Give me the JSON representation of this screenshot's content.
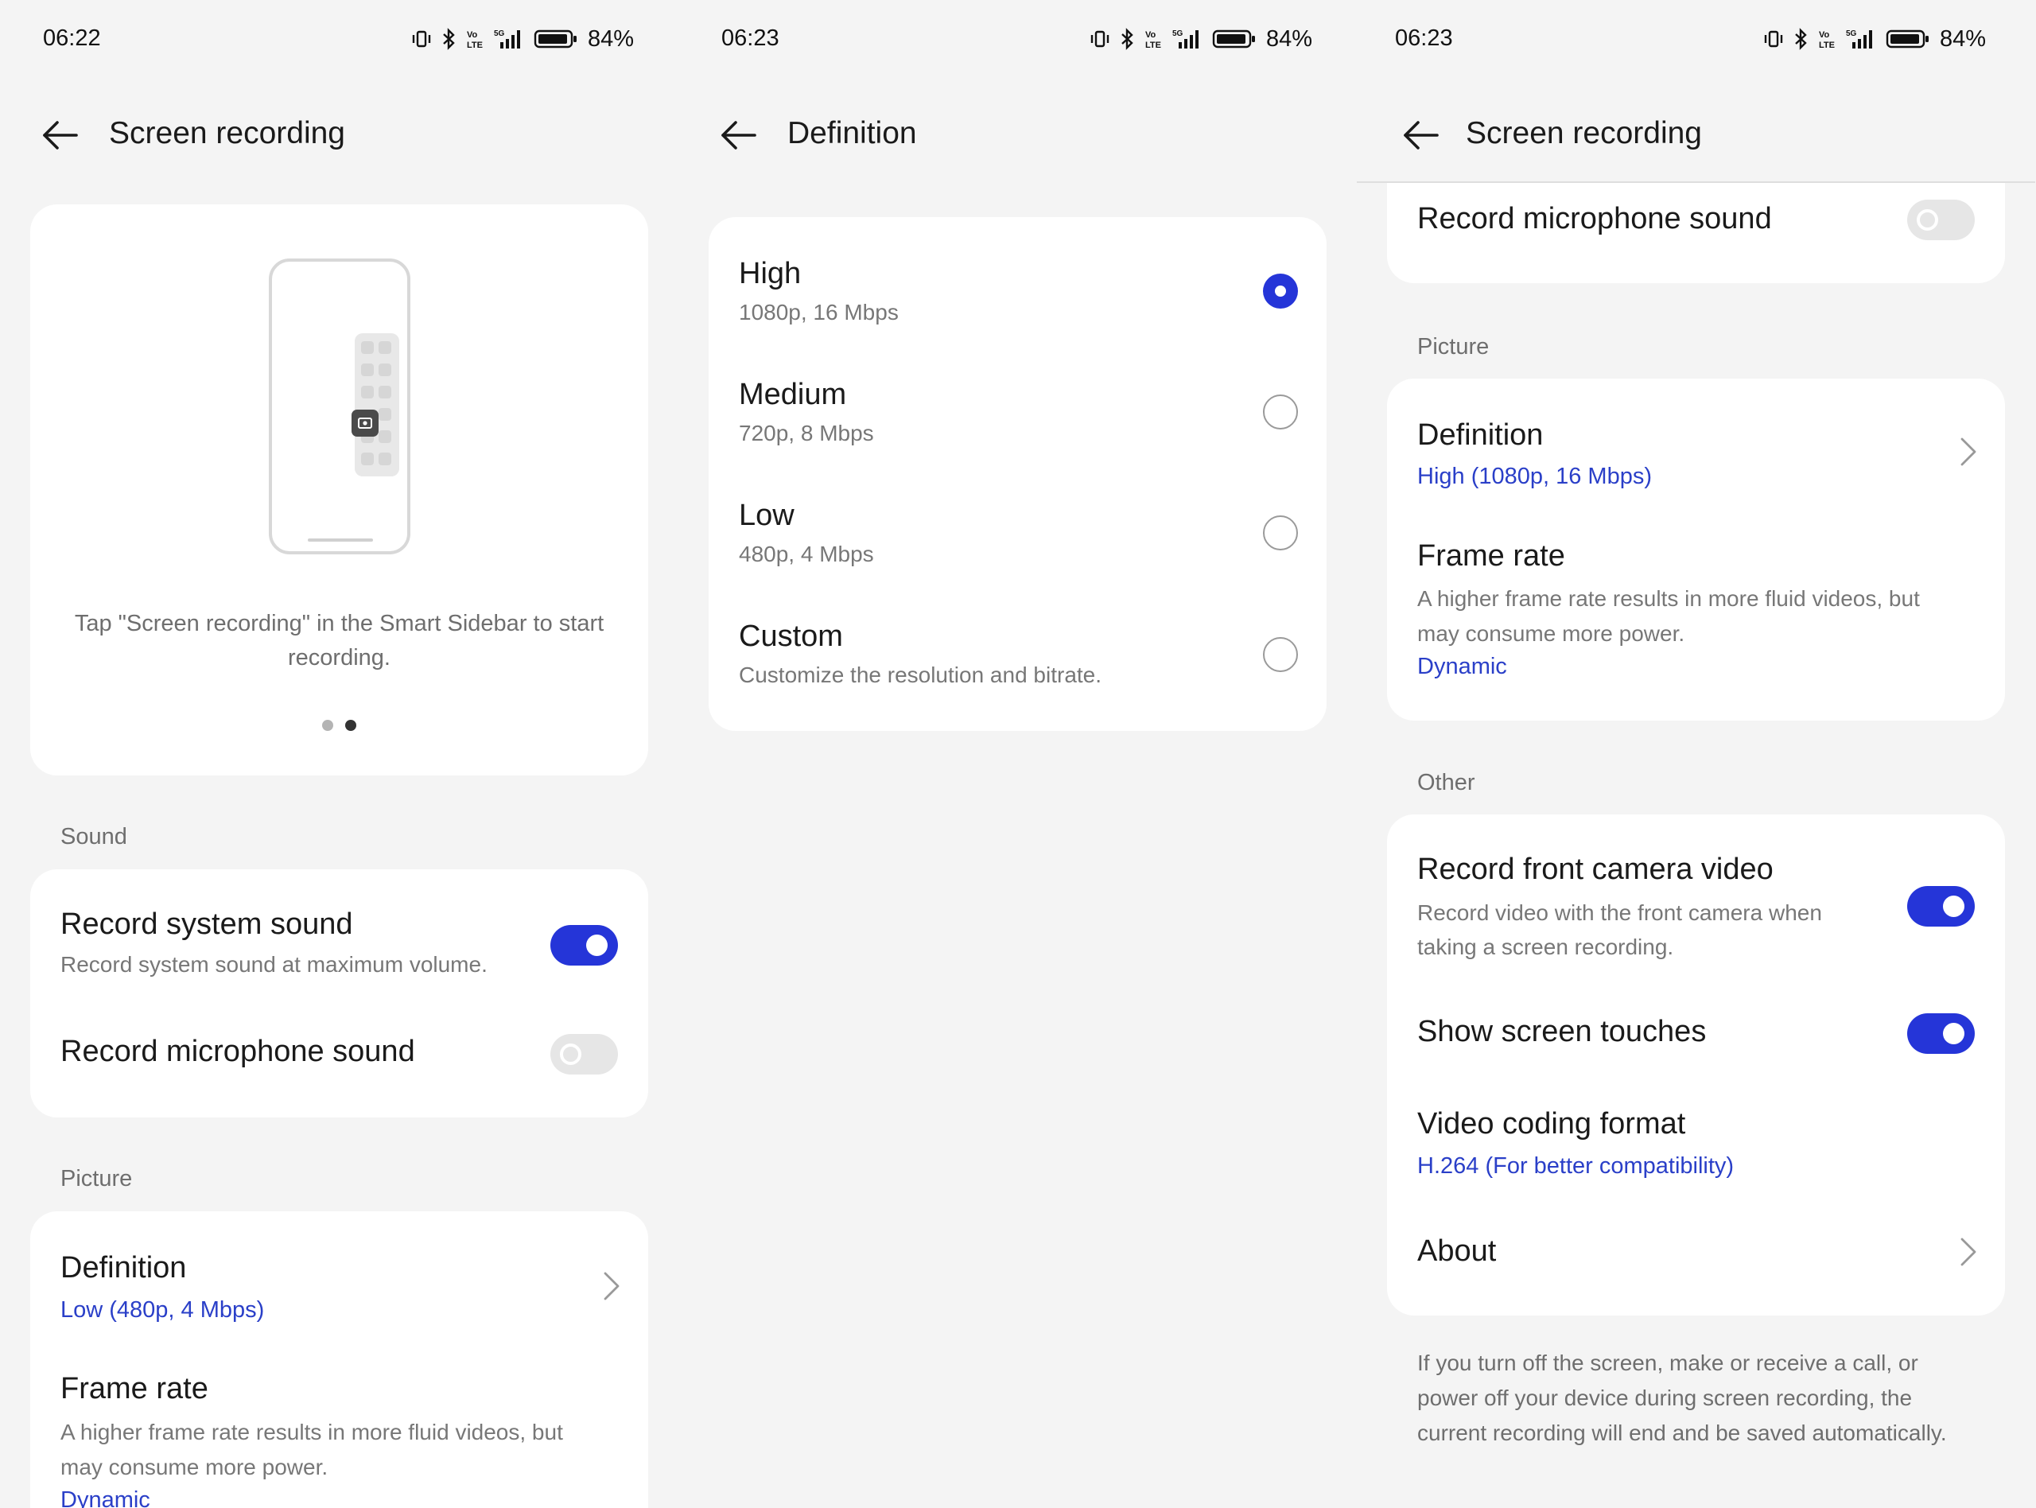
{
  "screen1": {
    "status": {
      "time": "06:22",
      "battery": "84%",
      "network": "5G"
    },
    "header": {
      "title": "Screen recording"
    },
    "illustration": {
      "caption": "Tap \"Screen recording\" in the Smart Sidebar to start recording.",
      "page_indicator": {
        "total": 2,
        "active": 2
      }
    },
    "sound_section": {
      "label": "Sound",
      "items": [
        {
          "title": "Record system sound",
          "subtitle": "Record system sound at maximum volume.",
          "enabled": true
        },
        {
          "title": "Record microphone sound",
          "enabled": false
        }
      ]
    },
    "picture_section": {
      "label": "Picture",
      "definition": {
        "title": "Definition",
        "value": "Low (480p, 4 Mbps)"
      },
      "frame_rate": {
        "title": "Frame rate",
        "subtitle_line1": "A higher frame rate results in more fluid videos, but",
        "subtitle_line2": "may consume more power.",
        "value": "Dynamic"
      }
    }
  },
  "screen2": {
    "status": {
      "time": "06:23",
      "battery": "84%",
      "network": "5G"
    },
    "header": {
      "title": "Definition"
    },
    "options": [
      {
        "title": "High",
        "subtitle": "1080p, 16 Mbps",
        "selected": true
      },
      {
        "title": "Medium",
        "subtitle": "720p, 8 Mbps",
        "selected": false
      },
      {
        "title": "Low",
        "subtitle": "480p, 4 Mbps",
        "selected": false
      },
      {
        "title": "Custom",
        "subtitle": "Customize the resolution and bitrate.",
        "selected": false
      }
    ]
  },
  "screen3": {
    "status": {
      "time": "06:23",
      "battery": "84%",
      "network": "5G"
    },
    "header": {
      "title": "Screen recording"
    },
    "mic_item": {
      "title": "Record microphone sound",
      "enabled": false
    },
    "picture_section": {
      "label": "Picture",
      "definition": {
        "title": "Definition",
        "value": "High (1080p, 16 Mbps)"
      },
      "frame_rate": {
        "title": "Frame rate",
        "subtitle_line1": "A higher frame rate results in more fluid videos, but",
        "subtitle_line2": "may consume more power.",
        "value": "Dynamic"
      }
    },
    "other_section": {
      "label": "Other",
      "front_camera": {
        "title": "Record front camera video",
        "subtitle_line1": "Record video with the front camera when",
        "subtitle_line2": "taking a screen recording.",
        "enabled": true
      },
      "screen_touches": {
        "title": "Show screen touches",
        "enabled": true
      },
      "coding_format": {
        "title": "Video coding format",
        "value": "H.264 (For better compatibility)"
      },
      "about": {
        "title": "About"
      }
    },
    "footnote": {
      "line1": "If you turn off the screen, make or receive a call, or",
      "line2": "power off your device during screen recording, the",
      "line3": "current recording will end and be saved automatically."
    }
  },
  "colors": {
    "accent": "#2535d8",
    "link": "#2a3fc8",
    "background": "#f4f4f4",
    "card": "#ffffff"
  }
}
